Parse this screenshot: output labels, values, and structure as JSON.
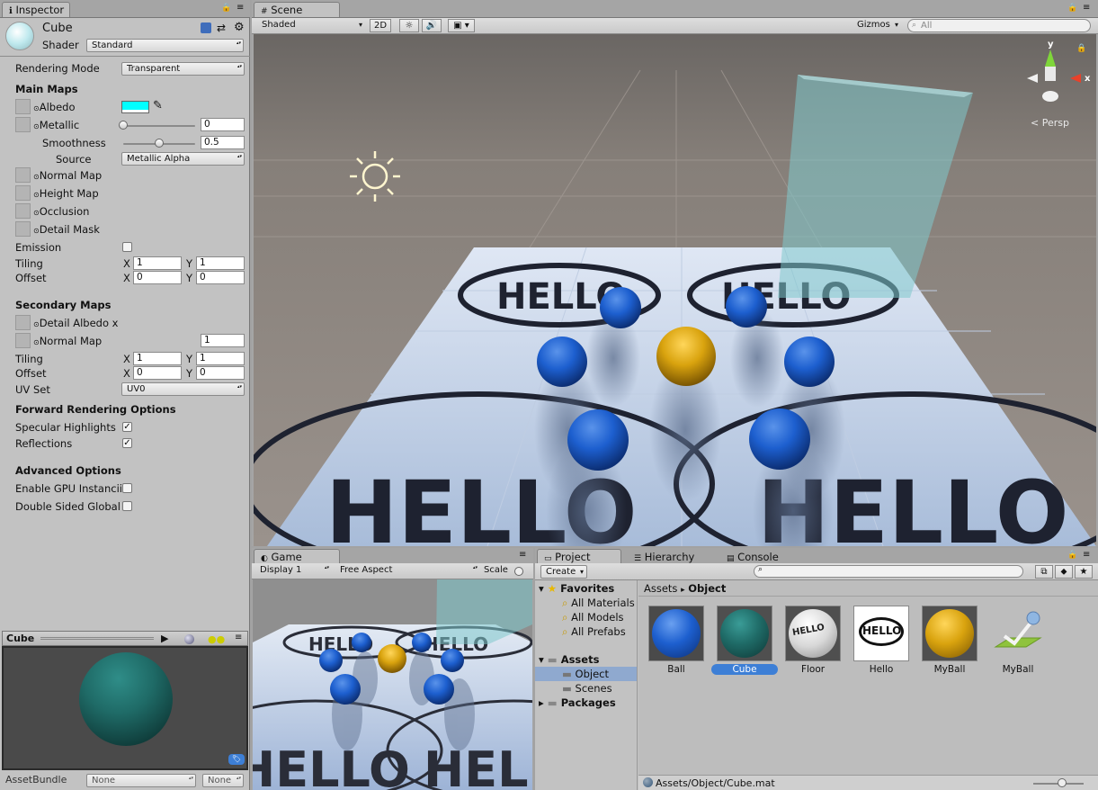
{
  "inspector": {
    "tab": "Inspector",
    "material_name": "Cube",
    "shader_label": "Shader",
    "shader_value": "Standard",
    "rendering_mode_label": "Rendering Mode",
    "rendering_mode_value": "Transparent",
    "main_maps": "Main Maps",
    "albedo": "Albedo",
    "albedo_color": "#00ffff",
    "metallic": "Metallic",
    "metallic_value": "0",
    "metallic_level": 0,
    "smoothness": "Smoothness",
    "smoothness_value": "0.5",
    "smoothness_level": 0.5,
    "source": "Source",
    "source_value": "Metallic Alpha",
    "normal_map": "Normal Map",
    "height_map": "Height Map",
    "occlusion": "Occlusion",
    "detail_mask": "Detail Mask",
    "emission": "Emission",
    "tiling": "Tiling",
    "offset": "Offset",
    "x": "X",
    "y": "Y",
    "tiling_x": "1",
    "tiling_y": "1",
    "offset_x": "0",
    "offset_y": "0",
    "secondary_maps": "Secondary Maps",
    "detail_albedo": "Detail Albedo x",
    "sec_normal_map": "Normal Map",
    "sec_normal_value": "1",
    "sec_tiling_x": "1",
    "sec_tiling_y": "1",
    "sec_offset_x": "0",
    "sec_offset_y": "0",
    "uv_set": "UV Set",
    "uv_set_value": "UV0",
    "forward_options": "Forward Rendering Options",
    "specular": "Specular Highlights",
    "reflections": "Reflections",
    "advanced": "Advanced Options",
    "gpu_instancing": "Enable GPU Instancii",
    "double_sided": "Double Sided Global",
    "check": "✓"
  },
  "preview": {
    "title": "Cube",
    "assetbundle_label": "AssetBundle",
    "bundle_value": "None",
    "variant_value": "None",
    "sphere_color": "#1f6b67"
  },
  "scene": {
    "tab": "Scene",
    "shading": "Shaded",
    "btn_2d": "2D",
    "gizmos": "Gizmos",
    "search_placeholder": "All",
    "persp": "Persp",
    "axis_y": "y",
    "axis_x": "x",
    "hello": "HELLO"
  },
  "game": {
    "tab": "Game",
    "display": "Display 1",
    "aspect": "Free Aspect",
    "scale": "Scale"
  },
  "project": {
    "tab_project": "Project",
    "tab_hierarchy": "Hierarchy",
    "tab_console": "Console",
    "create": "Create",
    "favorites": "Favorites",
    "fav_items": [
      "All Materials",
      "All Models",
      "All Prefabs"
    ],
    "assets": "Assets",
    "asset_folders": [
      "Object",
      "Scenes"
    ],
    "packages": "Packages",
    "breadcrumb_root": "Assets",
    "breadcrumb_sep": "▸",
    "breadcrumb_current": "Object",
    "items": [
      {
        "name": "Ball",
        "kind": "blue-sphere"
      },
      {
        "name": "Cube",
        "kind": "teal-sphere"
      },
      {
        "name": "Floor",
        "kind": "floor-sphere"
      },
      {
        "name": "Hello",
        "kind": "hello-texture"
      },
      {
        "name": "MyBall",
        "kind": "gold-sphere"
      },
      {
        "name": "MyBall",
        "kind": "physic-material"
      }
    ],
    "hello_text": "HELLO",
    "status_path": "Assets/Object/Cube.mat"
  },
  "colors": {
    "selection": "#3d7fd6",
    "blue_ball": "#1d5fcf",
    "gold_ball": "#d9a30e",
    "glass": "#7fc8cc"
  }
}
